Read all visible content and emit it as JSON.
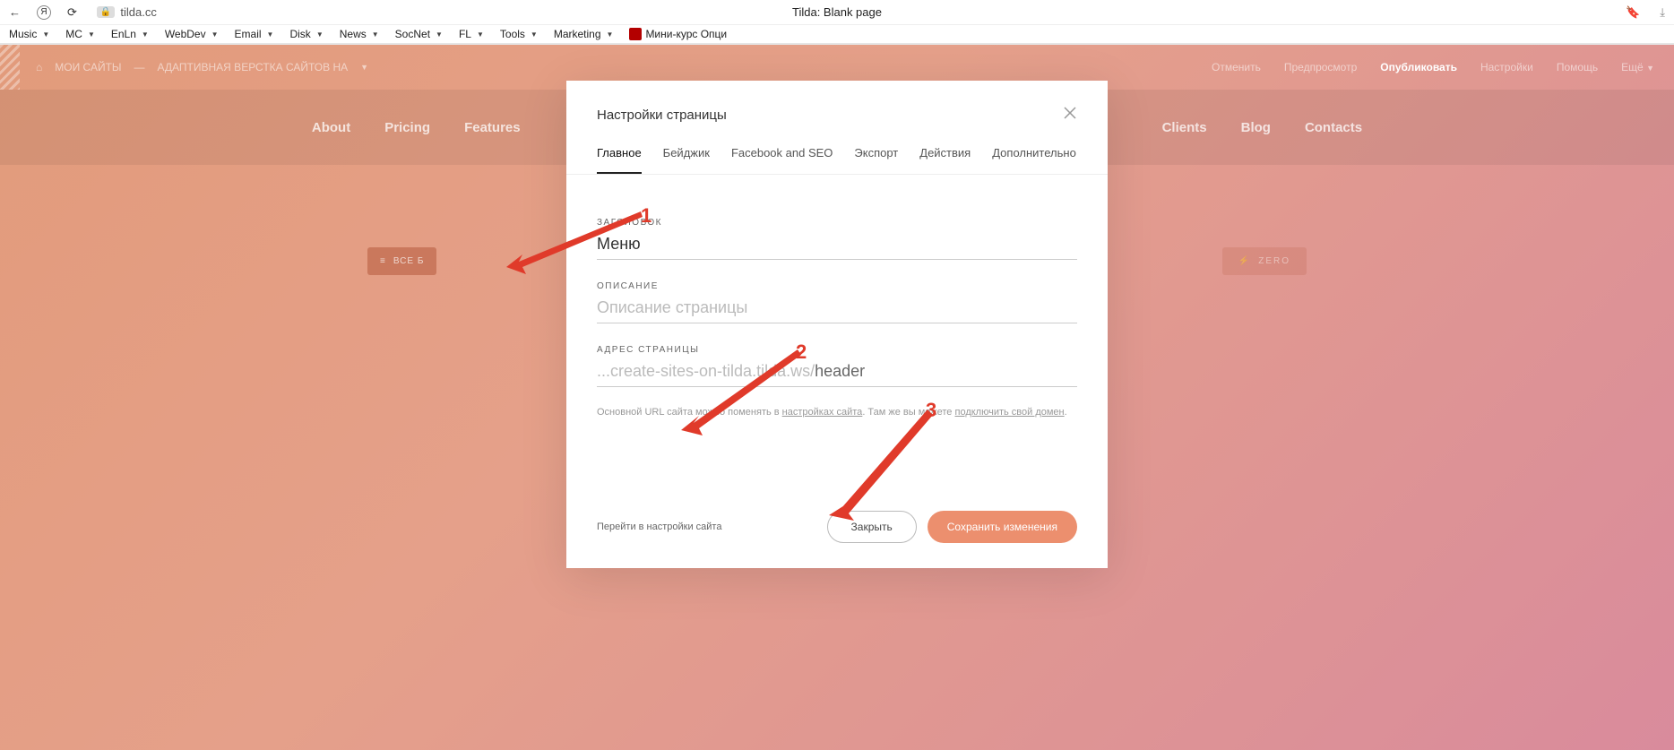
{
  "browser": {
    "address": "tilda.cc",
    "tab_title": "Tilda: Blank page"
  },
  "bookmarks": [
    {
      "label": "Music"
    },
    {
      "label": "MC"
    },
    {
      "label": "EnLn"
    },
    {
      "label": "WebDev"
    },
    {
      "label": "Email"
    },
    {
      "label": "Disk"
    },
    {
      "label": "News"
    },
    {
      "label": "SocNet"
    },
    {
      "label": "FL"
    },
    {
      "label": "Tools"
    },
    {
      "label": "Marketing"
    }
  ],
  "bookmark_extra": "Мини-курс Опци",
  "tilda_bar": {
    "crumb_home": "МОИ САЙТЫ",
    "crumb_project": "АДАПТИВНАЯ ВЕРСТКА САЙТОВ НА",
    "actions": {
      "undo": "Отменить",
      "preview": "Предпросмотр",
      "publish": "Опубликовать",
      "settings": "Настройки",
      "help": "Помощь",
      "more": "Ещё"
    }
  },
  "site_nav": [
    "About",
    "Pricing",
    "Features",
    "Clients",
    "Blog",
    "Contacts"
  ],
  "block_row": {
    "all_blocks": "ВСЕ Б",
    "zero": "ZERO"
  },
  "modal": {
    "title": "Настройки страницы",
    "tabs": [
      "Главное",
      "Бейджик",
      "Facebook and SEO",
      "Экспорт",
      "Действия",
      "Дополнительно"
    ],
    "active_tab": 0,
    "fields": {
      "title_label": "ЗАГОЛОВОК",
      "title_value": "Меню",
      "desc_label": "ОПИСАНИЕ",
      "desc_placeholder": "Описание страницы",
      "url_label": "АДРЕС СТРАНИЦЫ",
      "url_prefix": "...create-sites-on-tilda.tilda.ws/",
      "url_value": "header",
      "hint_a": "Основной URL сайта можно поменять в ",
      "hint_link1": "настройках сайта",
      "hint_b": ". Там же вы можете ",
      "hint_link2": "подключить свой домен",
      "hint_c": "."
    },
    "footer": {
      "link": "Перейти в настройки сайта",
      "close": "Закрыть",
      "save": "Сохранить изменения"
    }
  },
  "annotations": {
    "n1": "1",
    "n2": "2",
    "n3": "3"
  }
}
